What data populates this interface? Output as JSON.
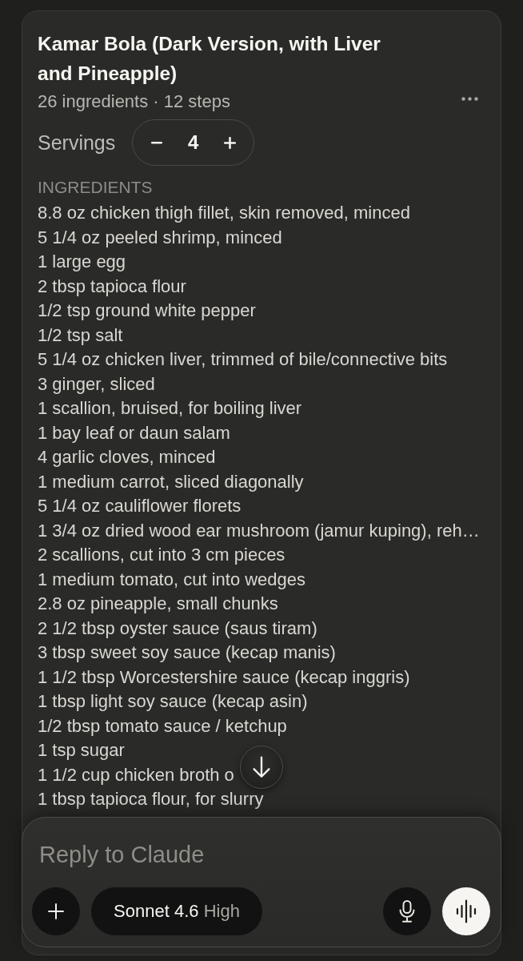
{
  "recipe": {
    "title": "Kamar Bola (Dark Version, with Liver and Pineapple)",
    "meta": "26 ingredients · 12 steps",
    "servings": {
      "label": "Servings",
      "value": "4"
    },
    "ingredients_heading": "INGREDIENTS",
    "ingredients": [
      "8.8 oz chicken thigh fillet, skin removed, minced",
      "5 1/4 oz peeled shrimp, minced",
      "1 large egg",
      "2 tbsp tapioca flour",
      "1/2 tsp ground white pepper",
      "1/2 tsp salt",
      "5 1/4 oz chicken liver, trimmed of bile/connective bits",
      "3 ginger, sliced",
      "1 scallion, bruised, for boiling liver",
      "1 bay leaf or daun salam",
      "4 garlic cloves, minced",
      "1 medium carrot, sliced diagonally",
      "5 1/4 oz cauliflower florets",
      "1 3/4 oz dried wood ear mushroom (jamur kuping), reh…",
      "2 scallions, cut into 3 cm pieces",
      "1 medium tomato, cut into wedges",
      "2.8 oz pineapple, small chunks",
      "2 1/2 tbsp oyster sauce (saus tiram)",
      "3 tbsp sweet soy sauce (kecap manis)",
      "1 1/2 tbsp Worcestershire sauce (kecap inggris)",
      "1 tbsp light soy sauce (kecap asin)",
      "1/2 tbsp tomato sauce / ketchup",
      "1 tsp sugar",
      "1 1/2 cup chicken broth o",
      "1 tbsp tapioca flour, for slurry"
    ]
  },
  "composer": {
    "placeholder": "Reply to Claude",
    "model": {
      "name": "Sonnet 4.6",
      "effort": "High"
    }
  }
}
